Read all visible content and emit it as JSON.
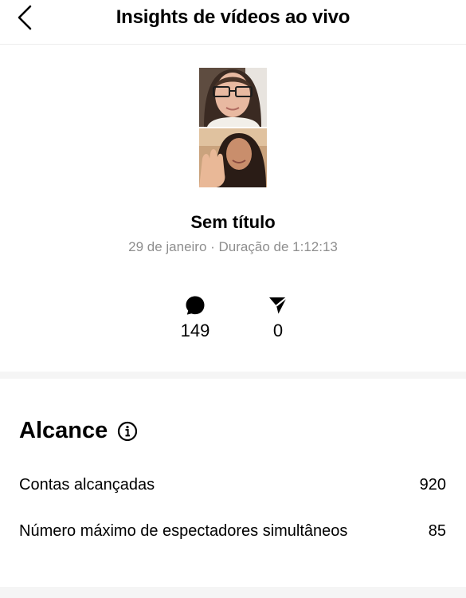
{
  "header": {
    "title": "Insights de vídeos ao vivo",
    "back_icon": "chevron-left-icon"
  },
  "live": {
    "title": "Sem título",
    "meta": "29 de janeiro · Duração de 1:12:13"
  },
  "stats": {
    "comments": {
      "icon": "comment-bubble-icon",
      "value": "149"
    },
    "shares": {
      "icon": "paper-plane-icon",
      "value": "0"
    }
  },
  "reach": {
    "title": "Alcance",
    "info_icon": "info-icon",
    "rows": [
      {
        "label": "Contas alcançadas",
        "value": "920"
      },
      {
        "label": "Número máximo de espectadores simultâneos",
        "value": "85"
      }
    ]
  }
}
